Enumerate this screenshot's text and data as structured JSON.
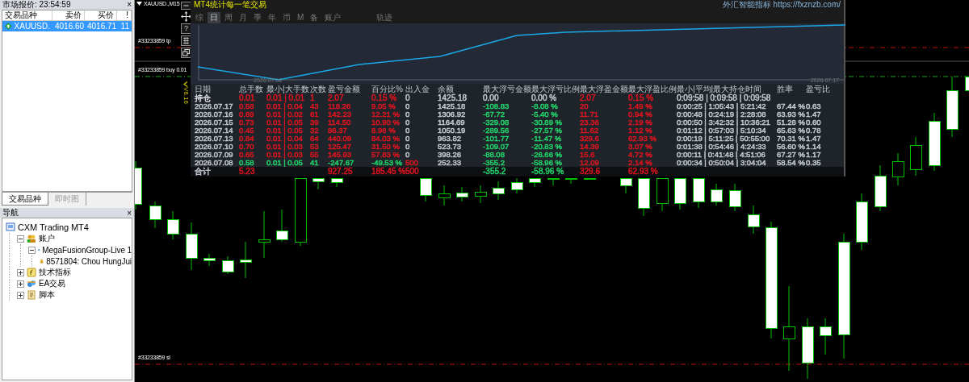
{
  "market_watch": {
    "title": "市场报价: 23:54:59",
    "close": "×",
    "columns": [
      "交易品种",
      "卖价",
      "买价",
      "!"
    ],
    "rows": [
      {
        "symbol": "XAUUSD.",
        "bid": "4016.60",
        "ask": "4016.71",
        "spread": "11",
        "selected": true
      }
    ],
    "tabs": [
      {
        "label": "交易品种",
        "selected": true
      },
      {
        "label": "即时图",
        "selected": false
      }
    ]
  },
  "navigator": {
    "title": "导航",
    "close": "×",
    "tree": [
      {
        "label": "CXM Trading MT4",
        "kind": "terminal",
        "children": [
          {
            "label": "账户",
            "kind": "accounts",
            "expanded": true,
            "children": [
              {
                "label": "MegaFusionGroup-Live 1",
                "kind": "server",
                "expanded": true,
                "children": [
                  {
                    "label": "8571804: Chou HungJui",
                    "kind": "account"
                  }
                ]
              }
            ]
          },
          {
            "label": "技术指标",
            "kind": "indicators",
            "expanded": false
          },
          {
            "label": "EA交易",
            "kind": "experts",
            "expanded": false
          },
          {
            "label": "脚本",
            "kind": "scripts",
            "expanded": false
          }
        ]
      }
    ]
  },
  "chart": {
    "title": "XAUUSD.,M15",
    "help_button": "?",
    "order_lines": [
      {
        "label": "#33233859 tp",
        "kind": "tp"
      },
      {
        "label": "#33233859 buy 0.01",
        "kind": "entry"
      },
      {
        "label": "#33233859 sl",
        "kind": "sl"
      }
    ]
  },
  "stats_panel": {
    "title": "MT4统计每一笔交易",
    "version": "V6.16",
    "link": "外汇智能指标 https://fxznzb.com/",
    "tabs": [
      {
        "label": "综",
        "selected": false
      },
      {
        "label": "日",
        "selected": true
      },
      {
        "label": "周",
        "selected": false
      },
      {
        "label": "月",
        "selected": false
      },
      {
        "label": "季",
        "selected": false
      },
      {
        "label": "年",
        "selected": false
      },
      {
        "label": "币",
        "selected": false
      },
      {
        "label": "M",
        "selected": false
      },
      {
        "label": "备",
        "selected": false
      },
      {
        "label": "账户",
        "selected": false
      },
      {
        "label": "轨迹",
        "selected": false
      }
    ],
    "equity_chart": {
      "start_date": "2026.07.08",
      "end_date": "2026.07.17"
    },
    "table": {
      "columns": [
        "日期",
        "总手数",
        "最小|大手数",
        "次数",
        "盈亏金额",
        "百分比%",
        "出入金",
        "余额",
        "最大浮亏金额",
        "最大浮亏比例",
        "最大浮盈金额",
        "最大浮盈比例",
        "最小|平均|最大持仓时间",
        "胜率",
        "盈亏比"
      ],
      "rows": [
        {
          "kind": "position",
          "cells": [
            {
              "text": "持仓",
              "color": "#d6dae0"
            },
            {
              "text": "0.01",
              "color": "#e0141e"
            },
            {
              "text": "0.01 | 0.01",
              "color": "#e0141e"
            },
            {
              "text": "1",
              "color": "#e0141e"
            },
            {
              "text": "2.07",
              "color": "#e0141e"
            },
            {
              "text": "0.15 %",
              "color": "#e0141e"
            },
            {
              "text": "0",
              "color": "#c4c9d0"
            },
            {
              "text": "1425.18",
              "color": "#c4c9d0"
            },
            {
              "text": "0.00",
              "color": "#c4c9d0"
            },
            {
              "text": "0.00 %",
              "color": "#c4c9d0"
            },
            {
              "text": "2.07",
              "color": "#e0141e"
            },
            {
              "text": "0.15 %",
              "color": "#e0141e"
            },
            {
              "text": "0:09:58 | 0:09:58 | 0:09:58",
              "color": "#c4c9d0"
            },
            null,
            null
          ]
        },
        {
          "kind": "day",
          "cells": [
            {
              "text": "2026.07.17",
              "color": "#c4c9d0"
            },
            {
              "text": "0.58",
              "color": "#e0141e"
            },
            {
              "text": "0.01 | 0.04",
              "color": "#e0141e"
            },
            {
              "text": "43",
              "color": "#e0141e"
            },
            {
              "text": "118.26",
              "color": "#e0141e"
            },
            {
              "text": "9.05 %",
              "color": "#e0141e"
            },
            {
              "text": "0",
              "color": "#c4c9d0"
            },
            {
              "text": "1425.18",
              "color": "#c4c9d0"
            },
            {
              "text": "-108.83",
              "color": "#22d46a"
            },
            {
              "text": "-8.08 %",
              "color": "#22d46a"
            },
            {
              "text": "20",
              "color": "#e0141e"
            },
            {
              "text": "1.49 %",
              "color": "#e0141e"
            },
            {
              "text": "0:00:25 | 1:05:43 | 5:21:42",
              "color": "#c4c9d0"
            },
            {
              "text": "67.44 %",
              "color": "#c4c9d0"
            },
            {
              "text": "0.63",
              "color": "#c4c9d0"
            }
          ]
        },
        {
          "kind": "day",
          "cells": [
            {
              "text": "2026.07.16",
              "color": "#c4c9d0"
            },
            {
              "text": "0.69",
              "color": "#e0141e"
            },
            {
              "text": "0.01 | 0.02",
              "color": "#e0141e"
            },
            {
              "text": "61",
              "color": "#e0141e"
            },
            {
              "text": "142.23",
              "color": "#e0141e"
            },
            {
              "text": "12.21 %",
              "color": "#e0141e"
            },
            {
              "text": "0",
              "color": "#c4c9d0"
            },
            {
              "text": "1306.92",
              "color": "#c4c9d0"
            },
            {
              "text": "-67.72",
              "color": "#22d46a"
            },
            {
              "text": "-5.40 %",
              "color": "#22d46a"
            },
            {
              "text": "11.71",
              "color": "#e0141e"
            },
            {
              "text": "0.94 %",
              "color": "#e0141e"
            },
            {
              "text": "0:00:48 | 0:24:19 | 2:28:08",
              "color": "#c4c9d0"
            },
            {
              "text": "63.93 %",
              "color": "#c4c9d0"
            },
            {
              "text": "1.47",
              "color": "#c4c9d0"
            }
          ]
        },
        {
          "kind": "day",
          "cells": [
            {
              "text": "2026.07.15",
              "color": "#c4c9d0"
            },
            {
              "text": "0.73",
              "color": "#e0141e"
            },
            {
              "text": "0.01 | 0.05",
              "color": "#e0141e"
            },
            {
              "text": "39",
              "color": "#e0141e"
            },
            {
              "text": "114.50",
              "color": "#e0141e"
            },
            {
              "text": "10.90 %",
              "color": "#e0141e"
            },
            {
              "text": "0",
              "color": "#c4c9d0"
            },
            {
              "text": "1164.69",
              "color": "#c4c9d0"
            },
            {
              "text": "-329.08",
              "color": "#22d46a"
            },
            {
              "text": "-30.89 %",
              "color": "#22d46a"
            },
            {
              "text": "23.36",
              "color": "#e0141e"
            },
            {
              "text": "2.19 %",
              "color": "#e0141e"
            },
            {
              "text": "0:00:50 | 3:42:32 | 10:36:21",
              "color": "#c4c9d0"
            },
            {
              "text": "51.28 %",
              "color": "#c4c9d0"
            },
            {
              "text": "0.60",
              "color": "#c4c9d0"
            }
          ]
        },
        {
          "kind": "day",
          "cells": [
            {
              "text": "2026.07.14",
              "color": "#c4c9d0"
            },
            {
              "text": "0.45",
              "color": "#e0141e"
            },
            {
              "text": "0.01 | 0.05",
              "color": "#e0141e"
            },
            {
              "text": "32",
              "color": "#e0141e"
            },
            {
              "text": "86.37",
              "color": "#e0141e"
            },
            {
              "text": "8.96 %",
              "color": "#e0141e"
            },
            {
              "text": "0",
              "color": "#c4c9d0"
            },
            {
              "text": "1050.19",
              "color": "#c4c9d0"
            },
            {
              "text": "-289.56",
              "color": "#22d46a"
            },
            {
              "text": "-27.57 %",
              "color": "#22d46a"
            },
            {
              "text": "11.62",
              "color": "#e0141e"
            },
            {
              "text": "1.12 %",
              "color": "#e0141e"
            },
            {
              "text": "0:01:12 | 0:57:03 | 5:10:34",
              "color": "#c4c9d0"
            },
            {
              "text": "65.63 %",
              "color": "#c4c9d0"
            },
            {
              "text": "0.78",
              "color": "#c4c9d0"
            }
          ]
        },
        {
          "kind": "day",
          "cells": [
            {
              "text": "2026.07.13",
              "color": "#c4c9d0"
            },
            {
              "text": "0.84",
              "color": "#e0141e"
            },
            {
              "text": "0.01 | 0.04",
              "color": "#e0141e"
            },
            {
              "text": "64",
              "color": "#e0141e"
            },
            {
              "text": "440.09",
              "color": "#e0141e"
            },
            {
              "text": "84.03 %",
              "color": "#e0141e"
            },
            {
              "text": "0",
              "color": "#c4c9d0"
            },
            {
              "text": "963.82",
              "color": "#c4c9d0"
            },
            {
              "text": "-101.77",
              "color": "#22d46a"
            },
            {
              "text": "-11.47 %",
              "color": "#22d46a"
            },
            {
              "text": "329.6",
              "color": "#e0141e"
            },
            {
              "text": "62.93 %",
              "color": "#e0141e"
            },
            {
              "text": "0:00:19 | 5:11:25 | 50:55:00",
              "color": "#c4c9d0"
            },
            {
              "text": "70.31 %",
              "color": "#c4c9d0"
            },
            {
              "text": "1.47",
              "color": "#c4c9d0"
            }
          ]
        },
        {
          "kind": "day",
          "cells": [
            {
              "text": "2026.07.10",
              "color": "#c4c9d0"
            },
            {
              "text": "0.70",
              "color": "#e0141e"
            },
            {
              "text": "0.01 | 0.03",
              "color": "#e0141e"
            },
            {
              "text": "53",
              "color": "#e0141e"
            },
            {
              "text": "125.47",
              "color": "#e0141e"
            },
            {
              "text": "31.50 %",
              "color": "#e0141e"
            },
            {
              "text": "0",
              "color": "#c4c9d0"
            },
            {
              "text": "523.73",
              "color": "#c4c9d0"
            },
            {
              "text": "-109.07",
              "color": "#22d46a"
            },
            {
              "text": "-20.83 %",
              "color": "#22d46a"
            },
            {
              "text": "14.39",
              "color": "#e0141e"
            },
            {
              "text": "3.07 %",
              "color": "#e0141e"
            },
            {
              "text": "0:01:38 | 0:54:46 | 4:24:33",
              "color": "#c4c9d0"
            },
            {
              "text": "56.60 %",
              "color": "#c4c9d0"
            },
            {
              "text": "1.14",
              "color": "#c4c9d0"
            }
          ]
        },
        {
          "kind": "day",
          "cells": [
            {
              "text": "2026.07.09",
              "color": "#c4c9d0"
            },
            {
              "text": "0.65",
              "color": "#e0141e"
            },
            {
              "text": "0.01 | 0.03",
              "color": "#e0141e"
            },
            {
              "text": "55",
              "color": "#e0141e"
            },
            {
              "text": "145.93",
              "color": "#e0141e"
            },
            {
              "text": "57.83 %",
              "color": "#e0141e"
            },
            {
              "text": "0",
              "color": "#c4c9d0"
            },
            {
              "text": "398.26",
              "color": "#c4c9d0"
            },
            {
              "text": "-88.08",
              "color": "#22d46a"
            },
            {
              "text": "-26.66 %",
              "color": "#22d46a"
            },
            {
              "text": "15.6",
              "color": "#e0141e"
            },
            {
              "text": "4.72 %",
              "color": "#e0141e"
            },
            {
              "text": "0:00:11 | 0:41:48 | 4:51:06",
              "color": "#c4c9d0"
            },
            {
              "text": "67.27 %",
              "color": "#c4c9d0"
            },
            {
              "text": "1.17",
              "color": "#c4c9d0"
            }
          ]
        },
        {
          "kind": "day",
          "cells": [
            {
              "text": "2026.07.08",
              "color": "#c4c9d0"
            },
            {
              "text": "0.58",
              "color": "#22d46a"
            },
            {
              "text": "0.01 | 0.05",
              "color": "#22d46a"
            },
            {
              "text": "41",
              "color": "#22d46a"
            },
            {
              "text": "-247.67",
              "color": "#22d46a"
            },
            {
              "text": "-49.53 %",
              "color": "#22d46a"
            },
            {
              "text": "500",
              "color": "#e0141e"
            },
            {
              "text": "252.33",
              "color": "#c4c9d0"
            },
            {
              "text": "-355.2",
              "color": "#22d46a"
            },
            {
              "text": "-58.96 %",
              "color": "#22d46a"
            },
            {
              "text": "12.09",
              "color": "#e0141e"
            },
            {
              "text": "2.14 %",
              "color": "#e0141e"
            },
            {
              "text": "0:00:34 | 0:50:04 | 3:04:04",
              "color": "#c4c9d0"
            },
            {
              "text": "58.54 %",
              "color": "#c4c9d0"
            },
            {
              "text": "0.35",
              "color": "#c4c9d0"
            }
          ]
        },
        {
          "kind": "total",
          "cells": [
            {
              "text": "合计",
              "color": "#c4c9d0"
            },
            {
              "text": "5.23",
              "color": "#e0141e"
            },
            null,
            null,
            {
              "text": "927.25",
              "color": "#e0141e"
            },
            {
              "text": "185.45 %",
              "color": "#e0141e"
            },
            {
              "text": "500",
              "color": "#e0141e"
            },
            null,
            {
              "text": "-355.2",
              "color": "#22d46a"
            },
            {
              "text": "-58.96 %",
              "color": "#22d46a"
            },
            {
              "text": "329.6",
              "color": "#e0141e"
            },
            {
              "text": "62.93 %",
              "color": "#e0141e"
            },
            null,
            null,
            null
          ]
        }
      ]
    }
  }
}
